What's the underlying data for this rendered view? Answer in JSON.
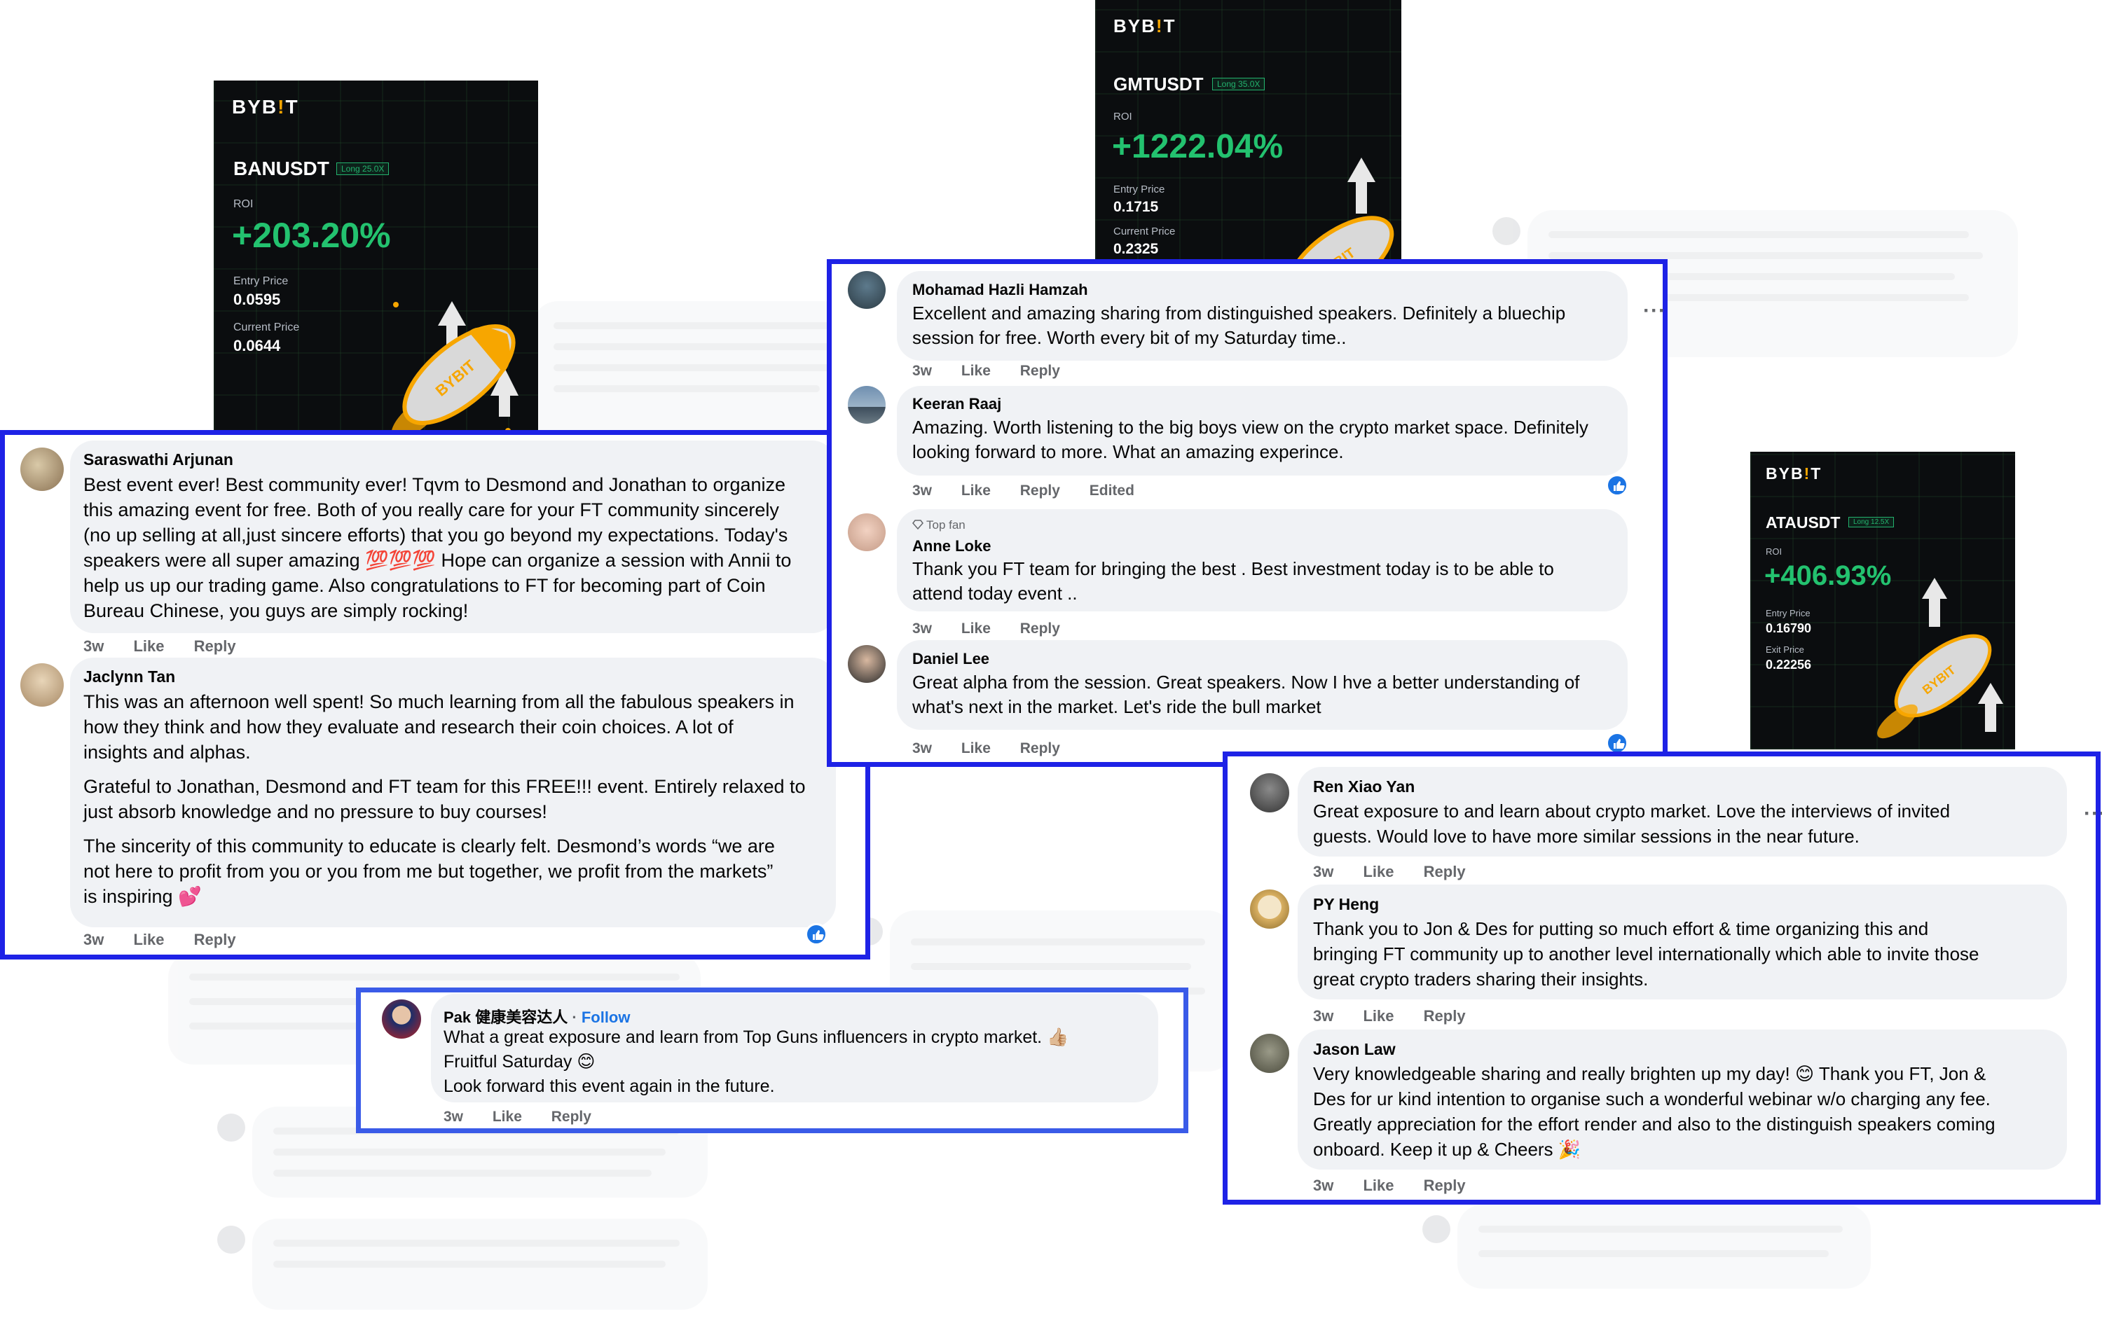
{
  "cards": [
    {
      "logo": "BYB!T",
      "pair": "BANUSDT",
      "badge": "Long 25.0X",
      "roi_label": "ROI",
      "roi": "+203.20%",
      "p1_label": "Entry Price",
      "p1": "0.0595",
      "p2_label": "Current Price",
      "p2": "0.0644"
    },
    {
      "logo": "BYB!T",
      "pair": "GMTUSDT",
      "badge": "Long 35.0X",
      "roi_label": "ROI",
      "roi": "+1222.04%",
      "p1_label": "Entry Price",
      "p1": "0.1715",
      "p2_label": "Current Price",
      "p2": "0.2325"
    },
    {
      "logo": "BYB!T",
      "pair": "ATAUSDT",
      "badge": "Long 12.5X",
      "roi_label": "ROI",
      "roi": "+406.93%",
      "p1_label": "Entry Price",
      "p1": "0.16790",
      "p2_label": "Exit Price",
      "p2": "0.22256"
    }
  ],
  "actions": {
    "time": "3w",
    "like": "Like",
    "reply": "Reply",
    "edited": "Edited",
    "follow": "Follow",
    "top_fan": "Top fan",
    "more": "···"
  },
  "panel_left": [
    {
      "name": "Saraswathi Arjunan",
      "lines": [
        "Best event ever! Best community ever! Tqvm to Desmond and Jonathan to organize",
        "this amazing event for free. Both of you really care for your FT community sincerely",
        "(no up selling at all,just sincere efforts) that you go beyond my expectations. Today's",
        "speakers were all super amazing 💯💯💯 Hope can organize a session with Annii to",
        "help us up our trading game. Also congratulations to FT for becoming part of Coin",
        "Bureau Chinese, you guys are simply rocking!"
      ]
    },
    {
      "name": "Jaclynn Tan",
      "lines": [
        "This was an afternoon well spent! So much learning from all the fabulous speakers in",
        "how they think and how they evaluate and research their coin choices. A lot of",
        "insights and alphas."
      ],
      "lines2": [
        "Grateful to Jonathan, Desmond and FT team for this FREE!!! event. Entirely relaxed to",
        "just absorb knowledge and no pressure to buy courses!"
      ],
      "lines3": [
        "The sincerity of this community to educate is clearly felt. Desmond’s words “we are",
        "not here to profit from you or you from me but together, we profit from the markets”",
        "is inspiring 💕"
      ]
    }
  ],
  "panel_center": [
    {
      "name": "Mohamad Hazli Hamzah",
      "lines": [
        "Excellent and amazing sharing from distinguished speakers. Definitely a bluechip",
        "session for free. Worth every bit of my Saturday time.."
      ]
    },
    {
      "name": "Keeran Raaj",
      "lines": [
        "Amazing. Worth listening to the big boys view on the crypto market space. Definitely",
        "looking forward to more. What an amazing experince."
      ]
    },
    {
      "name": "Anne Loke",
      "lines": [
        "Thank you FT team for bringing the best . Best investment today is to be able to",
        "attend today event .."
      ]
    },
    {
      "name": "Daniel Lee",
      "lines": [
        "Great alpha from the session. Great speakers. Now I hve a better understanding of",
        "what's next in the market. Let's ride the bull market"
      ]
    }
  ],
  "panel_pak": {
    "name": "Pak 健康美容达人",
    "lines": [
      "What a great exposure and learn from Top Guns influencers in crypto market. 👍🏼",
      "Fruitful Saturday 😊",
      "Look forward this event again in the future."
    ]
  },
  "panel_right": [
    {
      "name": "Ren Xiao Yan",
      "lines": [
        "Great exposure to and learn about crypto market. Love the interviews of invited",
        "guests. Would love to have more similar sessions in the near future."
      ]
    },
    {
      "name": "PY Heng",
      "lines": [
        "Thank you to Jon & Des for putting so much effort & time organizing this and",
        "bringing FT community up to another level internationally which able to invite those",
        "great crypto traders sharing their insights."
      ]
    },
    {
      "name": "Jason Law",
      "lines": [
        "Very knowledgeable sharing and really brighten up my day! 😊 Thank you FT, Jon &",
        "Des for ur kind intention to organise such a wonderful webinar w/o charging any fee.",
        "Greatly appreciation for the effort render and also to the distinguish speakers coming",
        "onboard. Keep it up & Cheers 🎉"
      ]
    }
  ]
}
